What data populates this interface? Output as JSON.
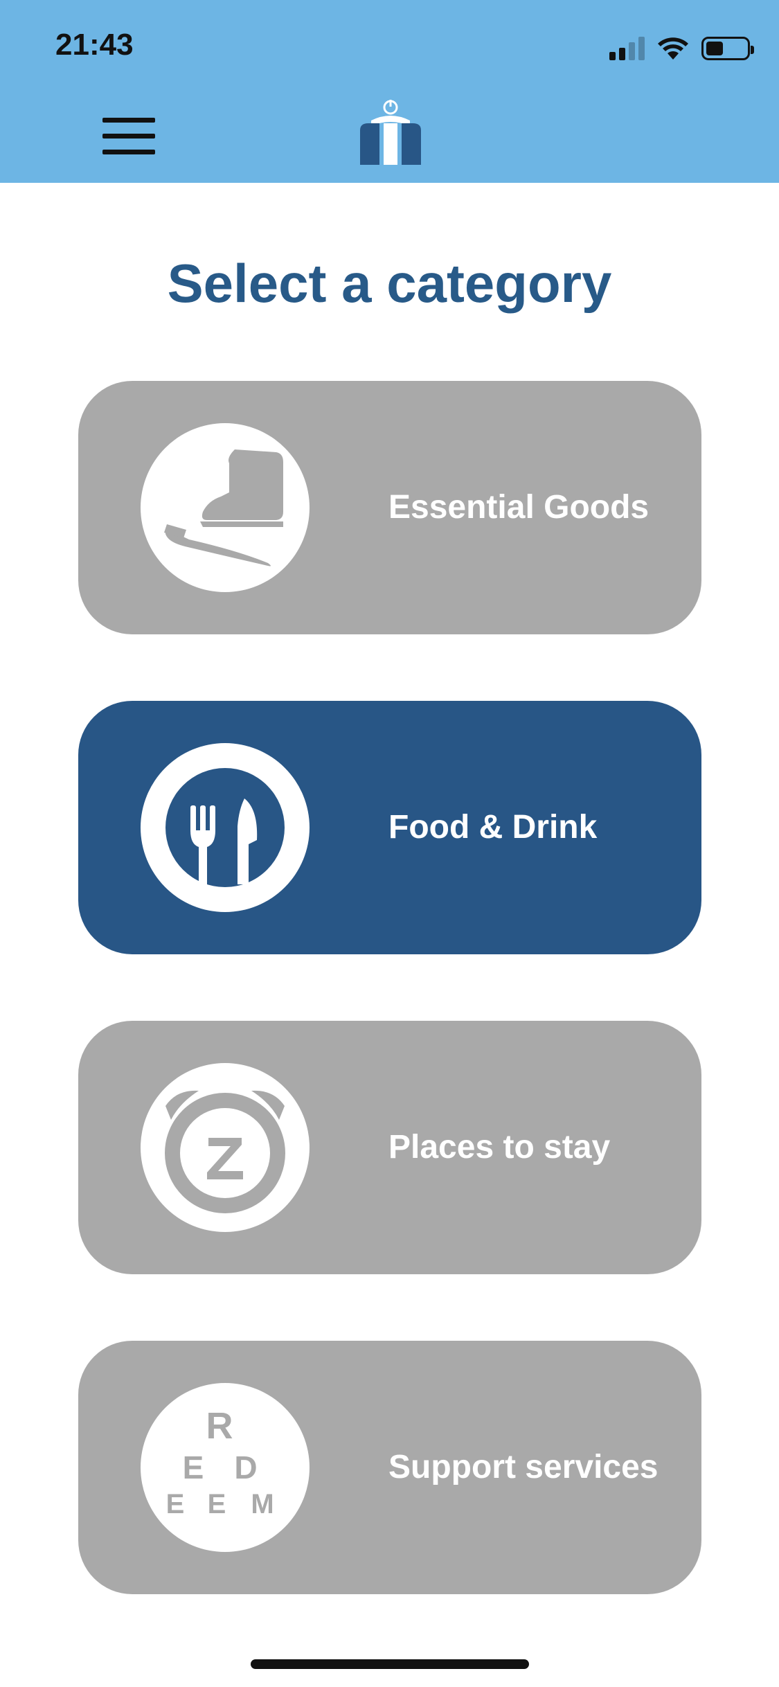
{
  "status_bar": {
    "time": "21:43",
    "icons": [
      "cellular-signal-icon",
      "wifi-icon",
      "battery-icon"
    ]
  },
  "header": {
    "menu_icon": "hamburger-menu-icon",
    "logo": "app-logo"
  },
  "page": {
    "title": "Select a category"
  },
  "categories": [
    {
      "label": "Essential Goods",
      "icon": "boot-toothbrush-icon",
      "selected": false
    },
    {
      "label": "Food & Drink",
      "icon": "fork-knife-icon",
      "selected": true
    },
    {
      "label": "Places to stay",
      "icon": "alarm-clock-z-icon",
      "selected": false
    },
    {
      "label": "Support services",
      "icon": "redeem-letters-icon",
      "selected": false,
      "icon_letters": [
        "R",
        "E",
        "D",
        "E",
        "E",
        "M"
      ]
    }
  ],
  "colors": {
    "header_bg": "#6db5e4",
    "title": "#285a88",
    "card_default": "#a9a9a9",
    "card_selected": "#285686",
    "card_text": "#ffffff"
  }
}
